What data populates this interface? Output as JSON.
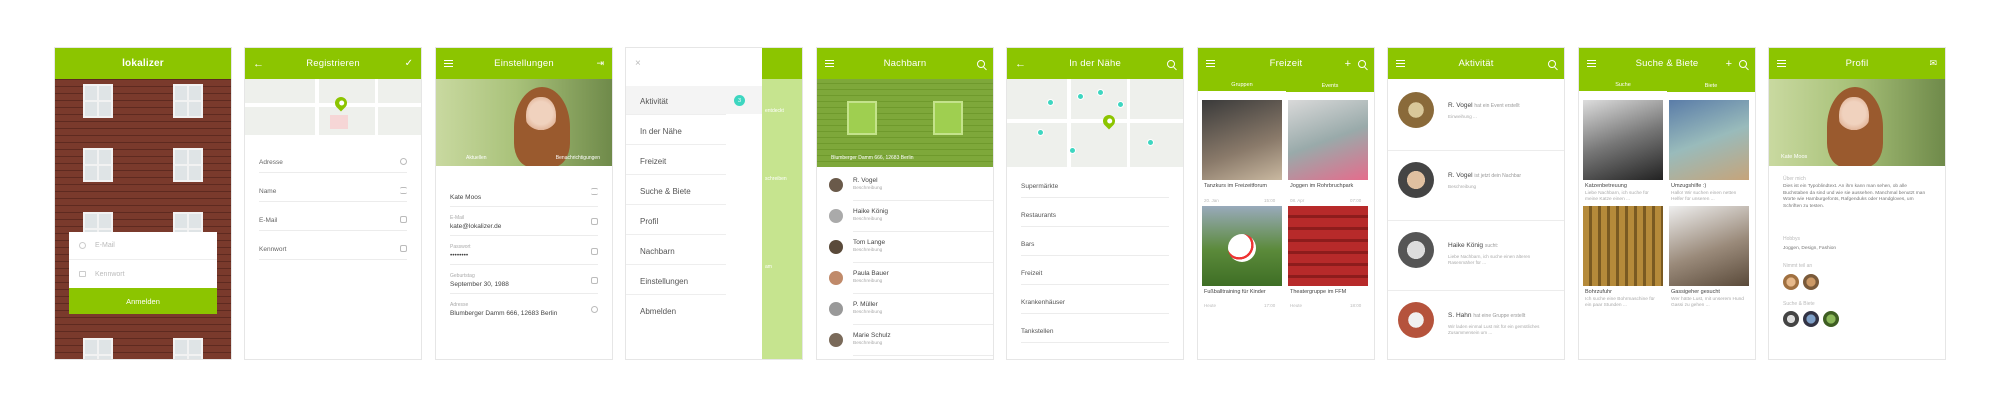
{
  "colors": {
    "accent": "#8cc500",
    "teal": "#3dd6c0"
  },
  "login": {
    "logo": "lokalizer",
    "email_placeholder": "E-Mail",
    "password_placeholder": "Kennwort",
    "login_button": "Anmelden"
  },
  "register": {
    "title": "Registrieren",
    "fields": [
      "Adresse",
      "Name",
      "E-Mail",
      "Kennwort"
    ]
  },
  "settings": {
    "title": "Einstellungen",
    "photo_left": "Aktuellen",
    "photo_right": "Benachrichtigungen",
    "name": "Kate Moos",
    "email_label": "E-Mail",
    "email": "kate@lokalizer.de",
    "password_label": "Passwort",
    "password": "••••••••",
    "birthday_label": "Geburtstag",
    "birthday": "September 30, 1988",
    "address_label": "Adresse",
    "address": "Blumberger Damm 666, 12683 Berlin"
  },
  "menu": {
    "items": [
      "Aktivität",
      "In der Nähe",
      "Freizeit",
      "Suche & Biete",
      "Profil",
      "Nachbarn",
      "Einstellungen",
      "Abmelden"
    ],
    "badge": "3",
    "peek": [
      "entdeckt",
      "schreiben",
      "am"
    ]
  },
  "neighbors": {
    "title": "Nachbarn",
    "address": "Blumberger Damm 666, 12683 Berlin",
    "people": [
      {
        "name": "R. Vogel",
        "desc": "Beschreibung"
      },
      {
        "name": "Haike König",
        "desc": "Beschreibung"
      },
      {
        "name": "Tom Lange",
        "desc": "Beschreibung"
      },
      {
        "name": "Paula Bauer",
        "desc": "Beschreibung"
      },
      {
        "name": "P. Müller",
        "desc": "Beschreibung"
      },
      {
        "name": "Marie Schulz",
        "desc": "Beschreibung"
      }
    ]
  },
  "nearby": {
    "title": "In der Nähe",
    "categories": [
      "Supermärkte",
      "Restaurants",
      "Bars",
      "Freizeit",
      "Krankenhäuser",
      "Tankstellen"
    ]
  },
  "leisure": {
    "title": "Freizeit",
    "tabs": [
      "Gruppen",
      "Events"
    ],
    "tiles": [
      "Tanzkurs im Freizeitforum",
      "Joggen im Rohrbruchpark",
      "Fußballtraining für Kinder",
      "Theatergruppe im FFM"
    ],
    "metas": [
      "20. Jan",
      "15:00",
      "08. Apr",
      "07:00",
      "Heute",
      "17:00",
      "Heute",
      "18:00"
    ]
  },
  "activity": {
    "title": "Aktivität",
    "items": [
      {
        "name": "R. Vogel",
        "action": "hat ein Event erstellt",
        "desc": "Einweihung ..."
      },
      {
        "name": "R. Vogel",
        "action": "ist jetzt dein Nachbar",
        "desc": "Beschreibung"
      },
      {
        "name": "Haike König",
        "action": "sucht:",
        "desc": "Liebe Nachbarn, ich suche einen älteren Rasenmäher für ..."
      },
      {
        "name": "S. Hahn",
        "action": "hat eine Gruppe erstellt",
        "desc": "Wir laden einmal Lust mit für ein gemütliches Zusammensein um ..."
      }
    ]
  },
  "search": {
    "title": "Suche & Biete",
    "tabs": [
      "Suche",
      "Biete"
    ],
    "tiles": [
      "Katzenbetreuung",
      "Umzugshilfe :)",
      "Bohrzufuhr",
      "Gassigeher gesucht"
    ],
    "descs": [
      "Liebe Nachbarn, ich suche für meine Katze einen ...",
      "Hallo! Wir suchen einen netten Helfer für unseren ...",
      "Ich suche eine Bohrmaschine für ein paar Stunden ...",
      "Wer hätte Lust, mit unserem Hund Gassi zu gehen ..."
    ]
  },
  "profile": {
    "title": "Profil",
    "name": "Kate Moos",
    "about_label": "Über mich",
    "about": "Dies ist ein Typoblindtext. An ihm kann man sehen, ob alle Buchstaben da sind und wie sie aussehen. Manchmal benutzt man Worte wie Hamburgefonts, Rafgenduks oder Handgloves, um Schriften zu testen.",
    "hobby_label": "Hobbys",
    "hobbies": "Joggen, Design, Fashion",
    "groups_label": "Nimmt teil an",
    "offers_label": "Suche & Biete"
  }
}
